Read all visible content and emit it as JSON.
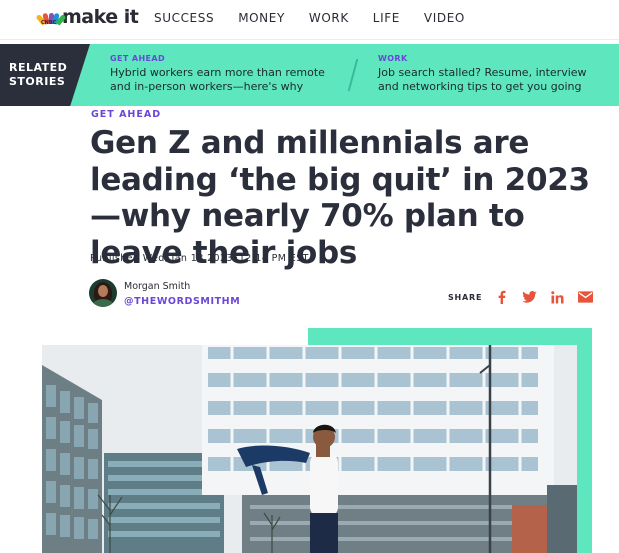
{
  "brand": {
    "logo_text": "make it",
    "network_label": "CNBC",
    "colors": {
      "accent_green": "#5ee6bf",
      "accent_purple": "#6b46d9",
      "dark": "#2b2f3c",
      "share_red": "#e8533c"
    }
  },
  "nav": {
    "links": [
      "SUCCESS",
      "MONEY",
      "WORK",
      "LIFE",
      "VIDEO"
    ]
  },
  "related": {
    "label_line1": "RELATED",
    "label_line2": "STORIES",
    "stories": [
      {
        "kicker": "GET AHEAD",
        "title": "Hybrid workers earn more than remote and in-person workers—here's why"
      },
      {
        "kicker": "WORK",
        "title": "Job search stalled? Resume, interview and networking tips to get you going"
      }
    ]
  },
  "article": {
    "kicker": "GET AHEAD",
    "headline": "Gen Z and millennials are leading ‘the big quit’ in 2023—why nearly 70% plan to leave their jobs",
    "published": "Published Wed, Jan 18 2023•12:14 PM EST",
    "author": {
      "name": "Morgan Smith",
      "handle": "@THEWORDSMITHM"
    },
    "share": {
      "label": "SHARE",
      "icons": [
        "facebook-icon",
        "twitter-icon",
        "linkedin-icon",
        "email-icon"
      ]
    }
  }
}
